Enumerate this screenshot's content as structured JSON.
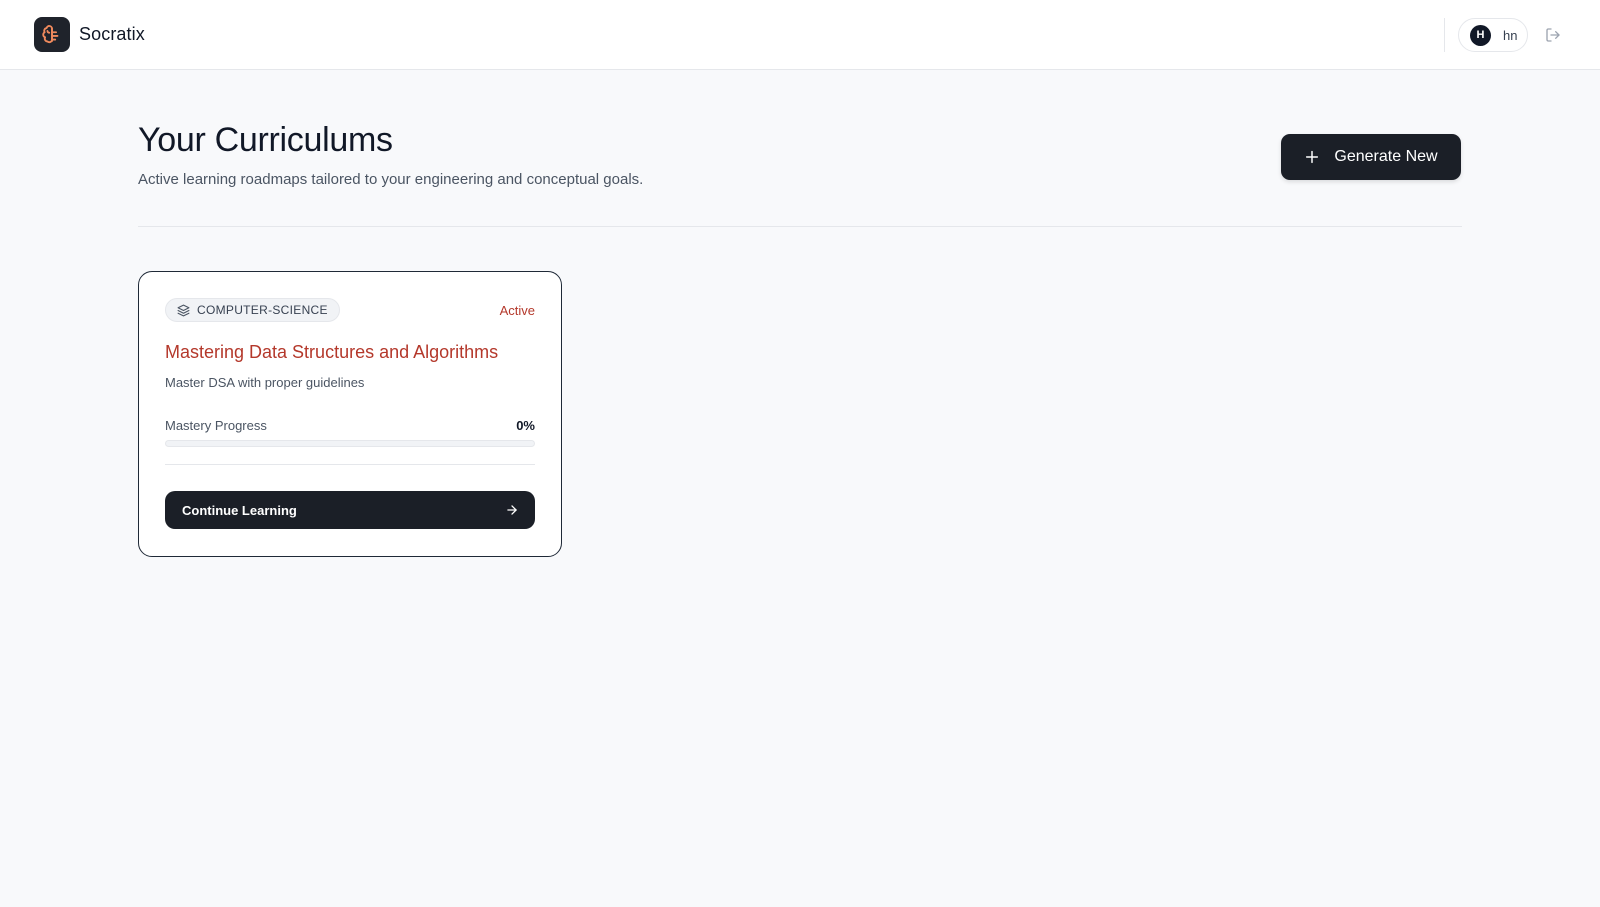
{
  "app": {
    "name": "Socratix"
  },
  "user": {
    "initial": "H",
    "name": "hn"
  },
  "page": {
    "title": "Your Curriculums",
    "subtitle": "Active learning roadmaps tailored to your engineering and conceptual goals.",
    "generate_label": "Generate New"
  },
  "curriculums": [
    {
      "category": "COMPUTER-SCIENCE",
      "status": "Active",
      "title": "Mastering Data Structures and Algorithms",
      "description": "Master DSA with proper guidelines",
      "progress_label": "Mastery Progress",
      "progress_text": "0%",
      "progress_fraction": 0,
      "cta_label": "Continue Learning"
    }
  ],
  "colors": {
    "accent": "#b4382b",
    "dark": "#1b1f27",
    "logo_glyph": "#f08a5d"
  },
  "icons": {
    "logo": "brain-logo-icon",
    "logout": "logout-icon",
    "plus": "plus-icon",
    "category": "layers-icon",
    "arrow": "arrow-right-icon"
  }
}
